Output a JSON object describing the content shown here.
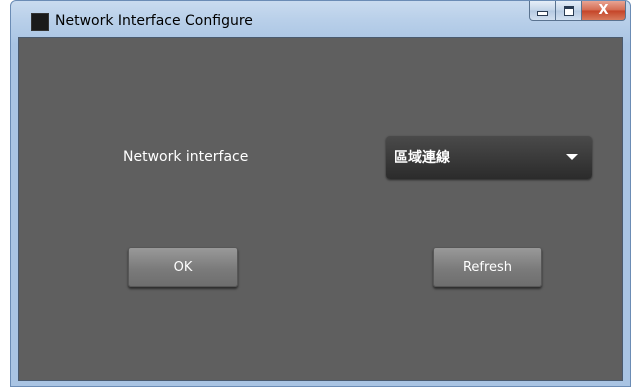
{
  "window": {
    "title": "Network Interface Configure",
    "icon": "app-icon",
    "caption": {
      "minimize_icon": "minimize-icon",
      "maximize_icon": "maximize-icon",
      "close_label": "X"
    }
  },
  "form": {
    "interface_label": "Network interface",
    "interface_select": {
      "selected": "區域連線",
      "icon": "chevron-down-icon"
    }
  },
  "buttons": {
    "ok_label": "OK",
    "refresh_label": "Refresh"
  },
  "colors": {
    "client_background": "#5f5f5f",
    "dropdown_background": "#333333",
    "button_background": "#888888",
    "text": "#ffffff"
  }
}
